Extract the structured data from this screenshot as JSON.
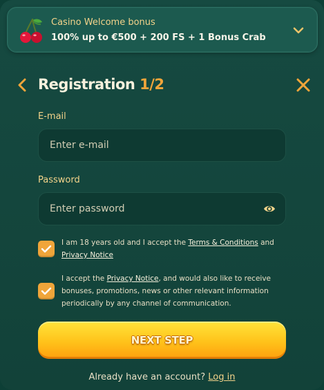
{
  "bonus": {
    "title": "Casino Welcome bonus",
    "description": "100% up to €500 + 200 FS + 1 Bonus Crab"
  },
  "header": {
    "title": "Registration",
    "step": "1/2"
  },
  "form": {
    "email": {
      "label": "E-mail",
      "placeholder": "Enter e-mail",
      "value": ""
    },
    "password": {
      "label": "Password",
      "placeholder": "Enter password",
      "value": ""
    }
  },
  "consents": [
    {
      "checked": true,
      "text_before": "I am 18 years old and I accept the ",
      "link1": "Terms & Conditions",
      "text_middle": " and ",
      "link2": "Privacy Notice"
    },
    {
      "checked": true,
      "text_before": "I accept the ",
      "link1": "Privacy Notice",
      "text_after": ", and would also like to receive bonuses, promotions, news or other relevant information periodically by any channel of communication."
    }
  ],
  "next_button": {
    "label": "NEXT STEP"
  },
  "footer": {
    "prompt": "Already have an account?",
    "link": "Log in"
  },
  "colors": {
    "background": "#164a41",
    "accent": "#f0a53a",
    "label": "#f3d38a",
    "button_gradient_top": "#ffe43a",
    "button_gradient_bottom": "#ff9f0e"
  },
  "icons": {
    "bonus": "cherry-icon",
    "expand": "chevron-down-icon",
    "back": "chevron-left-icon",
    "close": "close-icon",
    "password_toggle": "eye-icon",
    "checkbox": "check-icon"
  }
}
